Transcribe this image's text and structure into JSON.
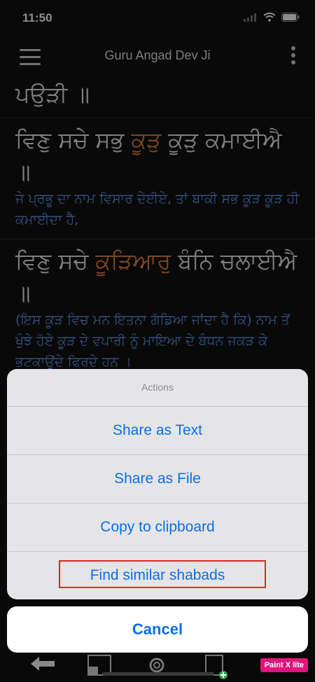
{
  "status": {
    "time": "11:50"
  },
  "app_bar": {
    "title": "Guru Angad Dev Ji"
  },
  "verses": [
    {
      "gurbani_parts": [
        "ਪਉੜੀ ॥"
      ],
      "meaning": ""
    },
    {
      "gurbani_parts": [
        "ਵਿਣੁ ਸਚੇ ਸਭੁ ",
        "ਕੂੜੁ",
        " ਕੂੜੁ ਕਮਾਈਐ ॥"
      ],
      "meaning": "ਜੇ ਪ੍ਰਭੂ ਦਾ ਨਾਮ ਵਿਸਾਰ ਦੇਈਏ, ਤਾਂ ਬਾਕੀ ਸਭ ਕੂੜ ਕੂੜ ਹੀ ਕਮਾਈਦਾ ਹੈ,"
    },
    {
      "gurbani_parts": [
        "ਵਿਣੁ ਸਚੇ ",
        "ਕੂੜਿਆਰੁ",
        " ਬੰਨਿ ਚਲਾਈਐ ॥"
      ],
      "meaning": "(ਇਸ ਕੂੜ ਵਿਚ ਮਨ ਇਤਨਾ ਗੱਡਿਆ ਜਾਂਦਾ ਹੈ ਕਿ) ਨਾਮ ਤੋਂ ਖੁੰਝੇ ਹੋਏ ਕੂੜ ਦੇ ਵਪਾਰੀ ਨੂੰ ਮਾਇਆ ਦੇ ਬੰਧਨ ਜਕੜ ਕੇ ਭਟਕਾਉਂਦੇ ਫਿਰਦੇ ਹਨ ।"
    }
  ],
  "action_sheet": {
    "title": "Actions",
    "items": [
      "Share as Text",
      "Share as File",
      "Copy to clipboard",
      "Find similar shabads"
    ],
    "cancel_label": "Cancel"
  },
  "watermark": "Paint X lite",
  "colors": {
    "accent": "#0a6fe8",
    "highlight_word": "#e8803a",
    "meaning": "#5b8ee3",
    "annotation_box": "#e02525"
  }
}
